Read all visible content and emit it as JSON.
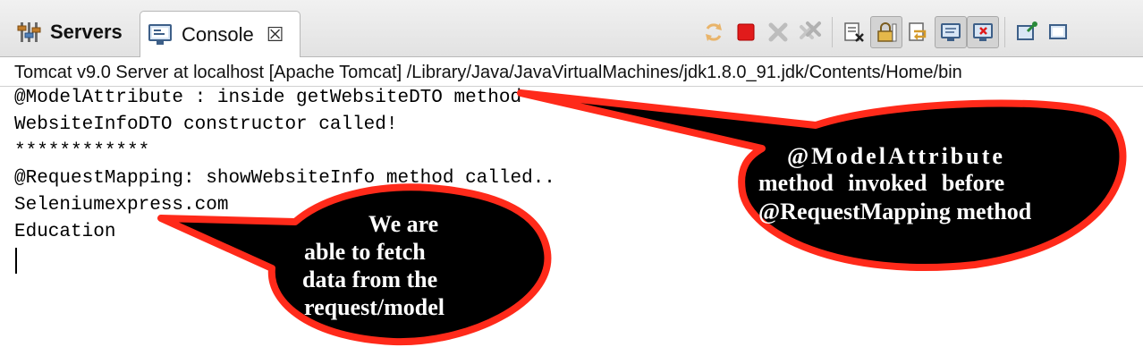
{
  "tabs": {
    "servers": {
      "label": "Servers",
      "icon": "servers-icon"
    },
    "console": {
      "label": "Console",
      "icon": "console-monitor-icon",
      "close": "☒"
    }
  },
  "toolbar": {
    "icons": [
      "refresh-icon",
      "terminate-stop-icon",
      "remove-launch-icon",
      "remove-all-terminated-icon",
      "clear-console-icon",
      "scroll-lock-icon",
      "word-wrap-icon",
      "show-on-stdout-icon",
      "show-on-stderr-icon",
      "pin-console-icon",
      "display-selected-console-icon"
    ]
  },
  "console": {
    "title": "Tomcat v9.0 Server at localhost [Apache Tomcat] /Library/Java/JavaVirtualMachines/jdk1.8.0_91.jdk/Contents/Home/bin",
    "lines": [
      "@ModelAttribute : inside getWebsiteDTO method",
      "WebsiteInfoDTO constructor called!",
      "************",
      "@RequestMapping: showWebsiteInfo method called..",
      "Seleniumexpress.com",
      "Education"
    ]
  },
  "annotations": {
    "right": [
      "@ModelAttribute",
      "method invoked before",
      "@RequestMapping method"
    ],
    "left": [
      "We are",
      "able to fetch",
      "data from the",
      "request/model"
    ]
  },
  "colors": {
    "callout_fill": "#000000",
    "callout_stroke": "#ff2a1a",
    "text": "#ffffff"
  }
}
